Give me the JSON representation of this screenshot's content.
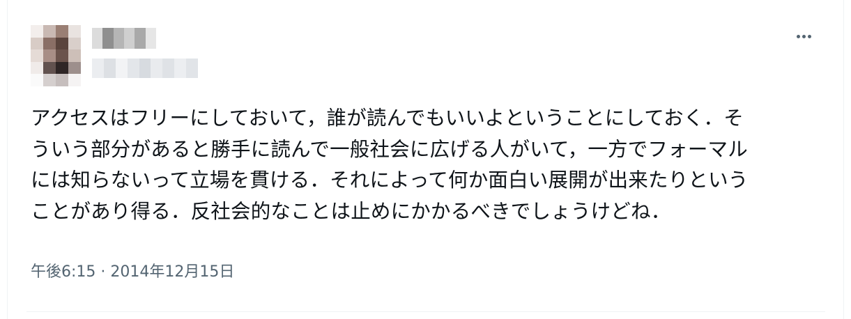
{
  "tweet": {
    "lines": [
      "アクセスはフリーにしておいて，誰が読んでもいいよということにしておく．そ",
      "ういう部分があると勝手に読んで一般社会に広げる人がいて，一方でフォーマル",
      "には知らないって立場を貫ける．それによって何か面白い展開が出来たりという",
      "ことがあり得る．反社会的なことは止めにかかるべきでしょうけどね．"
    ],
    "time": "午後6:15",
    "separator": "·",
    "date": "2014年12月15日"
  },
  "icons": {
    "more": "more-horizontal-icon"
  },
  "colors": {
    "text": "#0f1419",
    "secondary": "#536471",
    "divider": "#eff3f4"
  }
}
